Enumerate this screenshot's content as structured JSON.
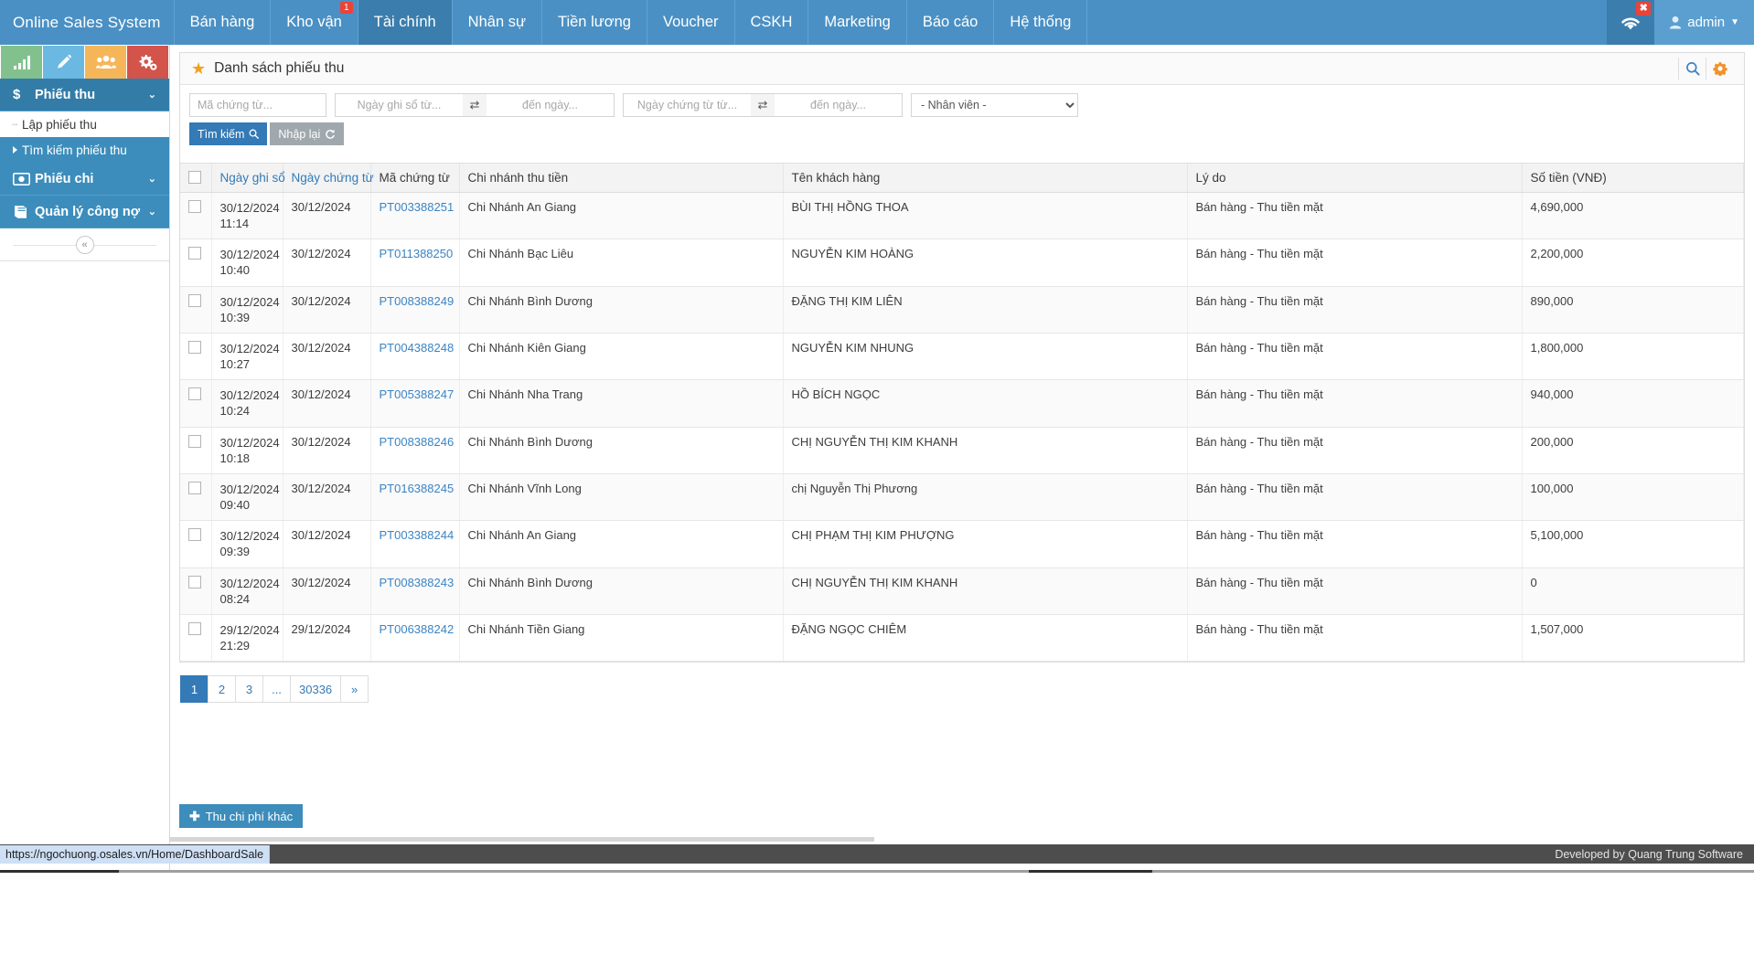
{
  "navbar": {
    "brand": "Online Sales System",
    "items": [
      {
        "label": "Bán hàng",
        "active": false,
        "badge": null
      },
      {
        "label": "Kho vận",
        "active": false,
        "badge": "1"
      },
      {
        "label": "Tài chính",
        "active": true,
        "badge": null
      },
      {
        "label": "Nhân sự",
        "active": false,
        "badge": null
      },
      {
        "label": "Tiền lương",
        "active": false,
        "badge": null
      },
      {
        "label": "Voucher",
        "active": false,
        "badge": null
      },
      {
        "label": "CSKH",
        "active": false,
        "badge": null
      },
      {
        "label": "Marketing",
        "active": false,
        "badge": null
      },
      {
        "label": "Báo cáo",
        "active": false,
        "badge": null
      },
      {
        "label": "Hệ thống",
        "active": false,
        "badge": null
      }
    ],
    "wifi_icon": "wifi-icon",
    "wifi_badge": "✖",
    "user_icon": "user-icon",
    "user_label": "admin",
    "user_caret": "▼"
  },
  "sidebar": {
    "quick_icons": [
      {
        "name": "chart-bar-icon",
        "color": "#82c18d"
      },
      {
        "name": "pencil-icon",
        "color": "#6bb9e2"
      },
      {
        "name": "users-icon",
        "color": "#f5b65a"
      },
      {
        "name": "gears-icon",
        "color": "#d3544a"
      }
    ],
    "groups": [
      {
        "label": "Phiếu thu",
        "icon": "dollar-icon",
        "icon_glyph": "$",
        "expanded": true,
        "chevron": "⌄",
        "items": [
          {
            "label": "Lập phiếu thu",
            "active": true
          },
          {
            "label": "Tìm kiếm phiếu thu",
            "active": false
          }
        ]
      },
      {
        "label": "Phiếu chi",
        "icon": "money-bill-icon",
        "icon_glyph": "▣",
        "expanded": false,
        "chevron": "⌄",
        "items": []
      },
      {
        "label": "Quản lý công nợ",
        "icon": "book-icon",
        "icon_glyph": "▤",
        "expanded": false,
        "chevron": "⌄",
        "items": []
      }
    ],
    "collapse_label": "«"
  },
  "panel": {
    "star_icon": "star-icon",
    "title": "Danh sách phiếu thu",
    "tools": [
      {
        "name": "search-icon",
        "color": "#3b84c4"
      },
      {
        "name": "gear-icon",
        "color": "#f0922b"
      }
    ]
  },
  "filters": {
    "doc_code_placeholder": "Mã chứng từ...",
    "doc_code_value": "",
    "book_date_from_placeholder": "Ngày ghi sổ từ...",
    "book_date_from_value": "",
    "book_date_to_placeholder": "đến ngày...",
    "book_date_to_value": "",
    "doc_date_from_placeholder": "Ngày chứng từ từ...",
    "doc_date_from_value": "",
    "doc_date_to_placeholder": "đến ngày...",
    "doc_date_to_value": "",
    "swap_icon": "swap-icon",
    "swap_glyph": "⇄",
    "employee_selected": "- Nhân viên -",
    "employee_options": [
      "- Nhân viên -"
    ],
    "search_button": "Tìm kiếm",
    "search_button_icon": "magnifier-icon",
    "reset_button": "Nhập lại",
    "reset_button_icon": "refresh-icon"
  },
  "table": {
    "columns": [
      {
        "key": "checkbox",
        "label": "",
        "sorted": false
      },
      {
        "key": "book_date",
        "label": "Ngày ghi sổ",
        "sorted": true
      },
      {
        "key": "doc_date",
        "label": "Ngày chứng từ",
        "sorted": true
      },
      {
        "key": "doc_code",
        "label": "Mã chứng từ",
        "sorted": false
      },
      {
        "key": "branch",
        "label": "Chi nhánh thu tiền",
        "sorted": false
      },
      {
        "key": "customer",
        "label": "Tên khách hàng",
        "sorted": false
      },
      {
        "key": "reason",
        "label": "Lý do",
        "sorted": false
      },
      {
        "key": "amount",
        "label": "Số tiền (VNĐ)",
        "sorted": false
      }
    ],
    "rows": [
      {
        "book_date": "30/12/2024",
        "book_time": "11:14",
        "doc_date": "30/12/2024",
        "doc_code": "PT003388251",
        "branch": "Chi Nhánh An Giang",
        "customer": "BÙI THỊ HỒNG THOA",
        "reason": "Bán hàng - Thu tiền mặt",
        "amount": "4,690,000"
      },
      {
        "book_date": "30/12/2024",
        "book_time": "10:40",
        "doc_date": "30/12/2024",
        "doc_code": "PT011388250",
        "branch": "Chi Nhánh Bạc Liêu",
        "customer": "NGUYỄN KIM HOÀNG",
        "reason": "Bán hàng - Thu tiền mặt",
        "amount": "2,200,000"
      },
      {
        "book_date": "30/12/2024",
        "book_time": "10:39",
        "doc_date": "30/12/2024",
        "doc_code": "PT008388249",
        "branch": "Chi Nhánh Bình Dương",
        "customer": "ĐẶNG THỊ KIM LIÊN",
        "reason": "Bán hàng - Thu tiền mặt",
        "amount": "890,000"
      },
      {
        "book_date": "30/12/2024",
        "book_time": "10:27",
        "doc_date": "30/12/2024",
        "doc_code": "PT004388248",
        "branch": "Chi Nhánh Kiên Giang",
        "customer": "NGUYỄN KIM NHUNG",
        "reason": "Bán hàng - Thu tiền mặt",
        "amount": "1,800,000"
      },
      {
        "book_date": "30/12/2024",
        "book_time": "10:24",
        "doc_date": "30/12/2024",
        "doc_code": "PT005388247",
        "branch": "Chi Nhánh Nha Trang",
        "customer": "HỒ BÍCH NGỌC",
        "reason": "Bán hàng - Thu tiền mặt",
        "amount": "940,000"
      },
      {
        "book_date": "30/12/2024",
        "book_time": "10:18",
        "doc_date": "30/12/2024",
        "doc_code": "PT008388246",
        "branch": "Chi Nhánh Bình Dương",
        "customer": "CHỊ NGUYỄN THỊ KIM KHANH",
        "reason": "Bán hàng - Thu tiền mặt",
        "amount": "200,000"
      },
      {
        "book_date": "30/12/2024",
        "book_time": "09:40",
        "doc_date": "30/12/2024",
        "doc_code": "PT016388245",
        "branch": "Chi Nhánh Vĩnh Long",
        "customer": "chị Nguyễn Thị Phương",
        "reason": "Bán hàng - Thu tiền mặt",
        "amount": "100,000"
      },
      {
        "book_date": "30/12/2024",
        "book_time": "09:39",
        "doc_date": "30/12/2024",
        "doc_code": "PT003388244",
        "branch": "Chi Nhánh An Giang",
        "customer": "CHỊ PHẠM THỊ KIM PHƯỢNG",
        "reason": "Bán hàng - Thu tiền mặt",
        "amount": "5,100,000"
      },
      {
        "book_date": "30/12/2024",
        "book_time": "08:24",
        "doc_date": "30/12/2024",
        "doc_code": "PT008388243",
        "branch": "Chi Nhánh Bình Dương",
        "customer": "CHỊ NGUYỄN THỊ KIM KHANH",
        "reason": "Bán hàng - Thu tiền mặt",
        "amount": "0"
      },
      {
        "book_date": "29/12/2024",
        "book_time": "21:29",
        "doc_date": "29/12/2024",
        "doc_code": "PT006388242",
        "branch": "Chi Nhánh Tiền Giang",
        "customer": "ĐẶNG NGỌC CHIÊM",
        "reason": "Bán hàng - Thu tiền mặt",
        "amount": "1,507,000"
      }
    ]
  },
  "pagination": {
    "pages": [
      {
        "label": "1",
        "active": true
      },
      {
        "label": "2",
        "active": false
      },
      {
        "label": "3",
        "active": false
      },
      {
        "label": "...",
        "active": false
      },
      {
        "label": "30336",
        "active": false
      },
      {
        "label": "»",
        "active": false
      }
    ]
  },
  "actions": {
    "add_button": "Thu chi phí khác",
    "add_button_icon": "plus-icon"
  },
  "statusbar": {
    "url": "https://ngochuong.osales.vn/Home/DashboardSale"
  },
  "footer": {
    "credit": "Developed by Quang Trung Software"
  },
  "colors": {
    "navbar": "#4a90c4",
    "nav_active": "#3b7ead",
    "sidebar": "#3c8dbc",
    "accent": "#337ab7",
    "link": "#3b84c4",
    "star": "#f0a020",
    "badge_red": "#e8443a"
  }
}
